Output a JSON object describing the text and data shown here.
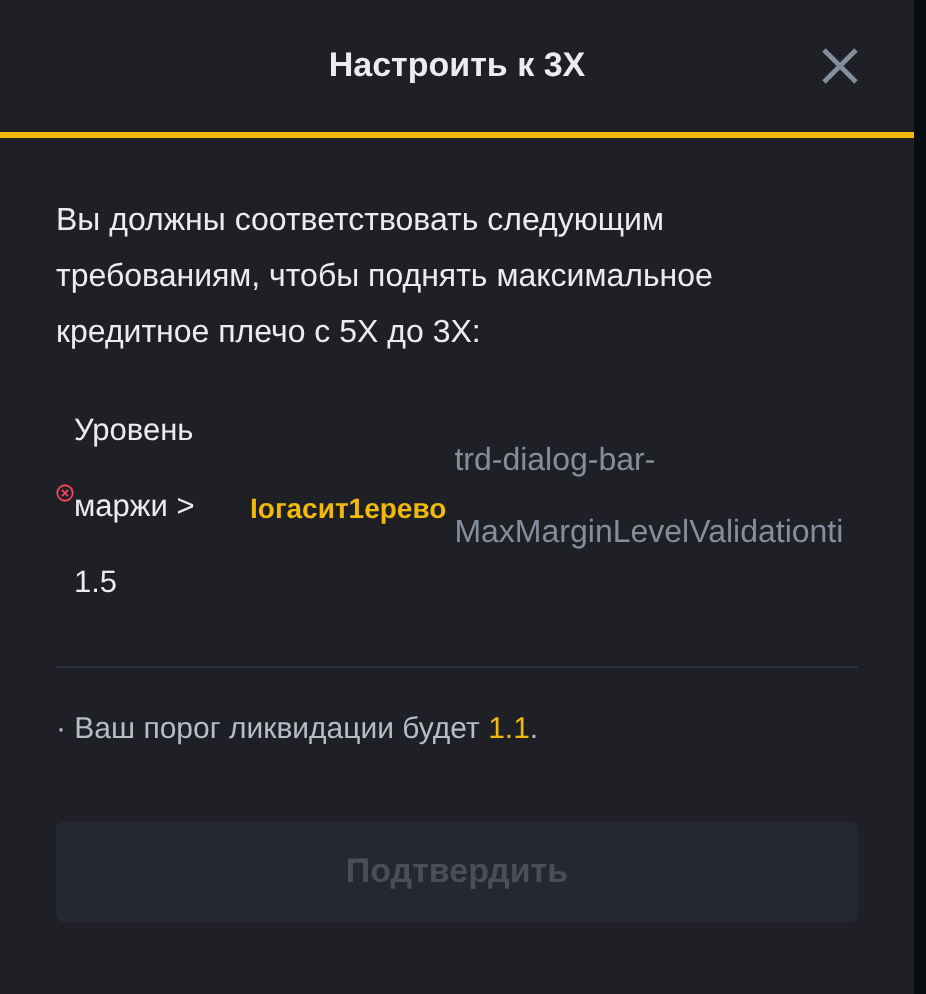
{
  "dialog": {
    "title": "Настроить к 3X",
    "intro": "Вы должны соответствовать следующим требованиям, чтобы поднять максимальное кредитное плечо с 5X до 3X:",
    "requirement": {
      "met": false,
      "label_lines": [
        "Уровень",
        "маржи >",
        "1.5"
      ],
      "link": "Іогасит1ерево",
      "key_lines": [
        "trd-dialog-bar-",
        "MaxMarginLevelValidationti"
      ]
    },
    "note": {
      "prefix": "· Ваш порог ликвидации будет ",
      "value": "1.1",
      "suffix": "."
    },
    "confirm": {
      "label": "Подтвердить",
      "disabled": true
    }
  }
}
